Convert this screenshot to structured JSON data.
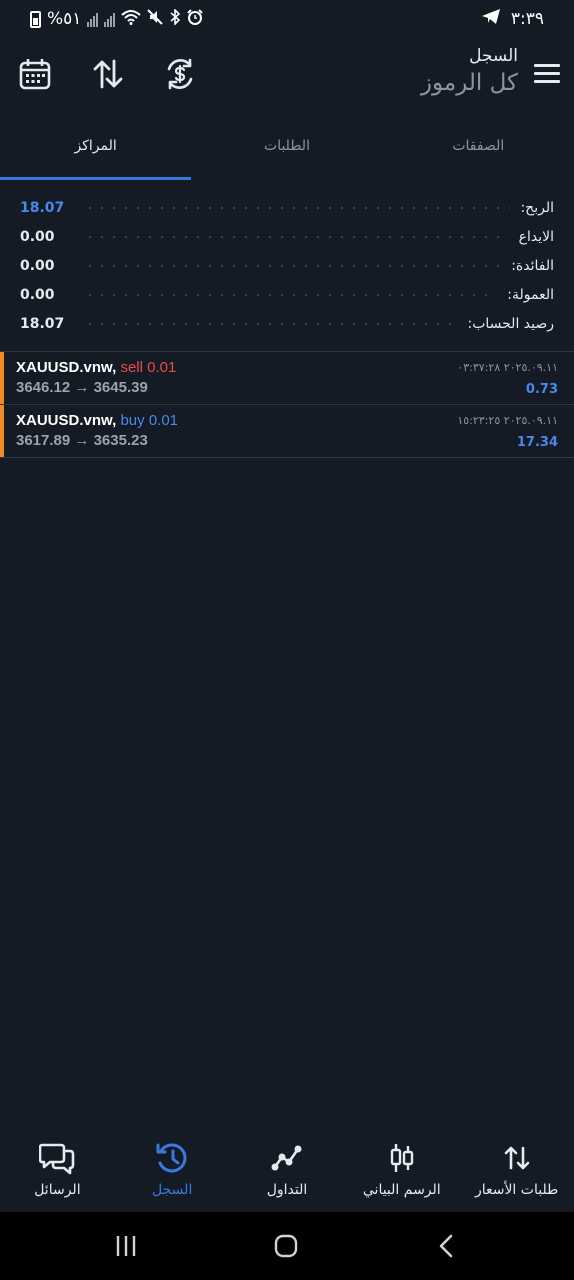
{
  "status_bar": {
    "time": "٣:٣٩",
    "battery": "%٥١",
    "icons": [
      "battery-icon",
      "signal-icon",
      "signal-icon",
      "wifi-icon",
      "mute-icon",
      "bluetooth-icon",
      "alarm-icon",
      "telegram-icon"
    ]
  },
  "header": {
    "subtitle": "السجل",
    "title": "كل الرموز",
    "icons": [
      "calendar-icon",
      "sort-icon",
      "currency-icon",
      "menu-icon"
    ]
  },
  "tabs": [
    {
      "label": "الصفقات",
      "active": false
    },
    {
      "label": "الطلبات",
      "active": false
    },
    {
      "label": "المراكز",
      "active": true
    }
  ],
  "summary": [
    {
      "label": "الربح:",
      "value": "18.07",
      "highlight": true
    },
    {
      "label": "الايداع",
      "value": "0.00",
      "highlight": false
    },
    {
      "label": "الفائدة:",
      "value": "0.00",
      "highlight": false
    },
    {
      "label": "العمولة:",
      "value": "0.00",
      "highlight": false
    },
    {
      "label": "رصيد الحساب:",
      "value": "18.07",
      "highlight": false
    }
  ],
  "positions": [
    {
      "symbol": "XAUUSD.vnw,",
      "direction": "sell 0.01",
      "type": "sell",
      "open_price": "3646.12",
      "arrow": "→",
      "close_price": "3645.39",
      "time": "٢٠٢٥.٠٩.١١ ٠٣:٣٧:٢٨",
      "profit": "0.73"
    },
    {
      "symbol": "XAUUSD.vnw,",
      "direction": "buy 0.01",
      "type": "buy",
      "open_price": "3617.89",
      "arrow": "→",
      "close_price": "3635.23",
      "time": "٢٠٢٥.٠٩.١١ ١٥:٢٣:٢٥",
      "profit": "17.34"
    }
  ],
  "bottom_nav": [
    {
      "label": "الرسائل",
      "icon": "chat-icon",
      "active": false
    },
    {
      "label": "السجل",
      "icon": "history-icon",
      "active": true
    },
    {
      "label": "التداول",
      "icon": "trade-icon",
      "active": false
    },
    {
      "label": "الرسم البياني",
      "icon": "candlestick-icon",
      "active": false
    },
    {
      "label": "طلبات الأسعار",
      "icon": "quotes-icon",
      "active": false
    }
  ],
  "colors": {
    "background": "#141b25",
    "accent": "#3a79df",
    "sell": "#e84b4b",
    "buy": "#4a88ec",
    "position_bar": "#f08a24"
  }
}
